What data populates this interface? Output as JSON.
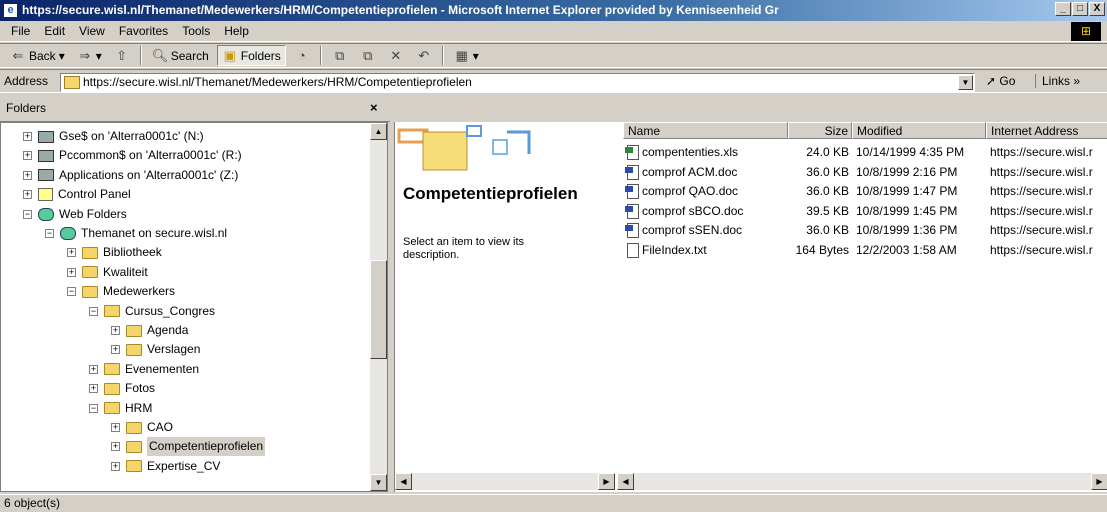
{
  "window": {
    "title": "https://secure.wisl.nl/Themanet/Medewerkers/HRM/Competentieprofielen - Microsoft Internet Explorer provided by Kenniseenheid Gr",
    "minimize": "_",
    "maximize": "□",
    "close": "X"
  },
  "menu": {
    "items": [
      "File",
      "Edit",
      "View",
      "Favorites",
      "Tools",
      "Help"
    ]
  },
  "toolbar": {
    "back": "Back",
    "search": "Search",
    "folders": "Folders"
  },
  "address": {
    "label": "Address",
    "value": "https://secure.wisl.nl/Themanet/Medewerkers/HRM/Competentieprofielen",
    "go": "Go",
    "links": "Links"
  },
  "folders": {
    "header": "Folders",
    "close": "×",
    "tree": [
      {
        "label": "Gse$ on 'Alterra0001c' (N:)",
        "icon": "drive",
        "exp": "+"
      },
      {
        "label": "Pccommon$ on 'Alterra0001c' (R:)",
        "icon": "drive",
        "exp": "+"
      },
      {
        "label": "Applications on 'Alterra0001c' (Z:)",
        "icon": "drive",
        "exp": "+"
      },
      {
        "label": "Control Panel",
        "icon": "cpanel",
        "exp": "+"
      },
      {
        "label": "Web Folders",
        "icon": "webf",
        "exp": "−"
      },
      {
        "label": "Themanet on secure.wisl.nl",
        "icon": "webf",
        "exp": "−"
      },
      {
        "label": "Bibliotheek",
        "icon": "folder",
        "exp": "+"
      },
      {
        "label": "Kwaliteit",
        "icon": "folder",
        "exp": "+"
      },
      {
        "label": "Medewerkers",
        "icon": "folder",
        "exp": "−"
      },
      {
        "label": "Cursus_Congres",
        "icon": "folder",
        "exp": "−"
      },
      {
        "label": "Agenda",
        "icon": "folder",
        "exp": "+"
      },
      {
        "label": "Verslagen",
        "icon": "folder",
        "exp": "+"
      },
      {
        "label": "Evenementen",
        "icon": "folder",
        "exp": "+"
      },
      {
        "label": "Fotos",
        "icon": "folder",
        "exp": "+"
      },
      {
        "label": "HRM",
        "icon": "folder",
        "exp": "−"
      },
      {
        "label": "CAO",
        "icon": "folder",
        "exp": "+"
      },
      {
        "label": "Competentieprofielen",
        "icon": "folder",
        "exp": "+"
      },
      {
        "label": "Expertise_CV",
        "icon": "folder",
        "exp": "+"
      }
    ]
  },
  "content": {
    "title": "Competentieprofielen",
    "description": "Select an item to view its description.",
    "columns": [
      "Name",
      "Size",
      "Modified",
      "Internet Address"
    ],
    "files": [
      {
        "name": "compententies.xls",
        "size": "24.0 KB",
        "modified": "10/14/1999 4:35 PM",
        "address": "https://secure.wisl.r",
        "type": "xls"
      },
      {
        "name": "comprof ACM.doc",
        "size": "36.0 KB",
        "modified": "10/8/1999 2:16 PM",
        "address": "https://secure.wisl.r",
        "type": "doc"
      },
      {
        "name": "comprof QAO.doc",
        "size": "36.0 KB",
        "modified": "10/8/1999 1:47 PM",
        "address": "https://secure.wisl.r",
        "type": "doc"
      },
      {
        "name": "comprof sBCO.doc",
        "size": "39.5 KB",
        "modified": "10/8/1999 1:45 PM",
        "address": "https://secure.wisl.r",
        "type": "doc"
      },
      {
        "name": "comprof sSEN.doc",
        "size": "36.0 KB",
        "modified": "10/8/1999 1:36 PM",
        "address": "https://secure.wisl.r",
        "type": "doc"
      },
      {
        "name": "FileIndex.txt",
        "size": "164 Bytes",
        "modified": "12/2/2003 1:58 AM",
        "address": "https://secure.wisl.r",
        "type": "txt"
      }
    ]
  },
  "status": {
    "objects": "6 object(s)"
  }
}
